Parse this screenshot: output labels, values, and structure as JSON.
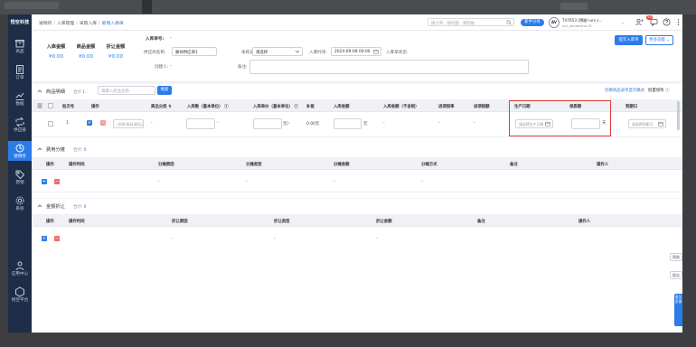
{
  "sidebar": {
    "logo": "悟空科技",
    "items": [
      {
        "label": "商品",
        "icon": "box-icon"
      },
      {
        "label": "订单",
        "icon": "order-icon"
      },
      {
        "label": "数据",
        "icon": "chart-icon"
      },
      {
        "label": "供应链",
        "icon": "supply-icon"
      },
      {
        "label": "进销存",
        "icon": "inventory-icon"
      },
      {
        "label": "营销",
        "icon": "tag-icon"
      },
      {
        "label": "系统",
        "icon": "gear-icon"
      },
      {
        "label": "应用中心",
        "icon": "apps-icon"
      },
      {
        "label": "悟空平台",
        "icon": "platform-icon"
      }
    ]
  },
  "header": {
    "breadcrumb": [
      "进销存",
      "入库管理",
      "采购入库",
      "新增入库单"
    ],
    "search_placeholder": "搜订单、搜问题、搜帮助",
    "new_button": "新手引导",
    "user_initials": "AV",
    "user_name": "T47053 (博雅!-uni  s...",
    "user_sub": "uni_vendorme  01",
    "notification_count": "53"
  },
  "summary": {
    "total_in_label": "入库金额",
    "total_in_value": "¥0.00",
    "goods_label": "商品金额",
    "goods_value": "¥0.00",
    "discount_label": "折让金额",
    "discount_value": "¥0.00",
    "order_no_label": "入库单号:",
    "order_no_value": "-",
    "warehouse_label": "供应商名称:",
    "warehouse_value": "廊坊供应商1",
    "buyer_label": "采购员:",
    "buyer_value": "请选择",
    "date_label": "入库时间:",
    "date_value": "2024-09-08 00:00",
    "status_label": "入库单状态:",
    "creator_label": "创建人:",
    "creator_value": "-",
    "remark_label": "备注:",
    "submit_button": "提交入库单",
    "more_button": "更多功能"
  },
  "goods": {
    "title": "商品明细",
    "count_prefix": "合计",
    "count": "1",
    "search_placeholder": "请输入商品名称",
    "search_button": "搜索",
    "switch_link": "切换商品录单显示模式",
    "batch_link": "批量修改",
    "columns": {
      "index": "批次号",
      "ops": "操作",
      "goods_class": "商品分类",
      "qty": "入库数（基本单位）",
      "price": "入库单价（基本单位）",
      "tax": "补差",
      "amount": "入库金额",
      "amount_notax": "入库金额（不含税）",
      "tax_rate": "进项税率",
      "tax_amount": "进项税额",
      "prod_date": "生产日期",
      "shelf_life": "保质期",
      "expiry": "到期日"
    },
    "row": {
      "index": "1",
      "goods_placeholder": "(名称/条码/助记)",
      "goods_class": "-",
      "qty_unit": "-",
      "price_unit": "元/-",
      "tax": "0.00元",
      "amount_unit": "元",
      "amount_notax": "-",
      "tax_rate": "-",
      "tax_amount": "-",
      "prod_date_placeholder": "请选择生产日期",
      "shelf_unit": "天",
      "expiry_placeholder": "请选择到期日"
    }
  },
  "fees": {
    "title": "费用分摊",
    "count_prefix": "合计:",
    "count": "0",
    "columns": [
      "操作",
      "操作时间",
      "分摊原因",
      "分摊类型",
      "分摊金额",
      "分摊方式",
      "备注",
      "操作人"
    ],
    "row": [
      "",
      "",
      "-",
      "-",
      "-",
      "-",
      "",
      ""
    ]
  },
  "discounts": {
    "title": "金额折让",
    "count_prefix": "合计:",
    "count": "0",
    "columns": [
      "操作",
      "操作时间",
      "折让原因",
      "折让类型",
      "折让金额",
      "备注",
      "操作人"
    ],
    "row": [
      "",
      "",
      "-",
      "-",
      "-",
      "",
      ""
    ]
  },
  "side_buttons": [
    "帮助",
    "报告"
  ],
  "feedback": "意见反馈"
}
